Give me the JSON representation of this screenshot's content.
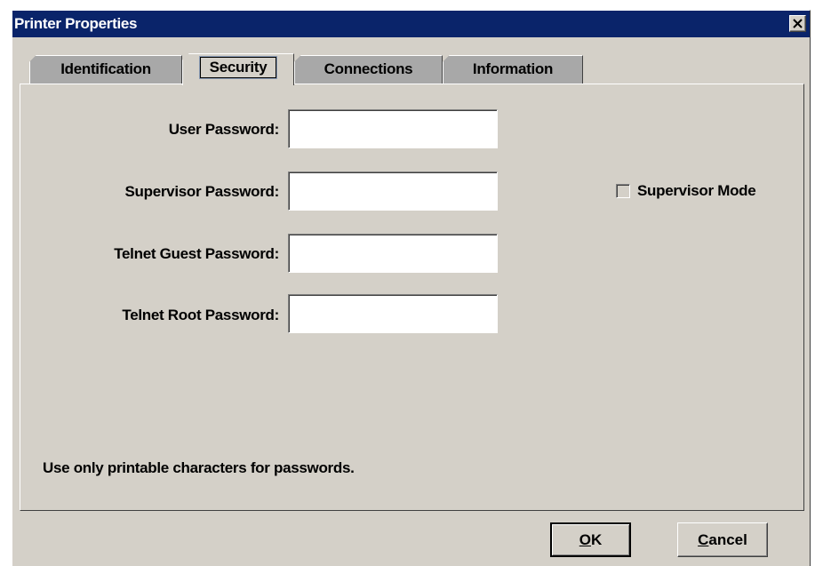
{
  "window": {
    "title": "Printer Properties"
  },
  "tabs": [
    {
      "label": "Identification",
      "active": false
    },
    {
      "label": "Security",
      "active": true
    },
    {
      "label": "Connections",
      "active": false
    },
    {
      "label": "Information",
      "active": false
    }
  ],
  "security": {
    "fields": [
      {
        "label": "User Password:",
        "value": ""
      },
      {
        "label": "Supervisor Password:",
        "value": ""
      },
      {
        "label": "Telnet Guest Password:",
        "value": ""
      },
      {
        "label": "Telnet Root Password:",
        "value": ""
      }
    ],
    "supervisor_mode": {
      "label": "Supervisor Mode",
      "checked": false
    },
    "hint": "Use only printable characters for passwords."
  },
  "buttons": {
    "ok_label": "OK",
    "cancel_label": "Cancel"
  },
  "colors": {
    "title_bar": "#0a246a",
    "face": "#d4d0c8",
    "inactive_tab": "#a8a8a8"
  },
  "icons": {
    "close": "close-icon"
  }
}
